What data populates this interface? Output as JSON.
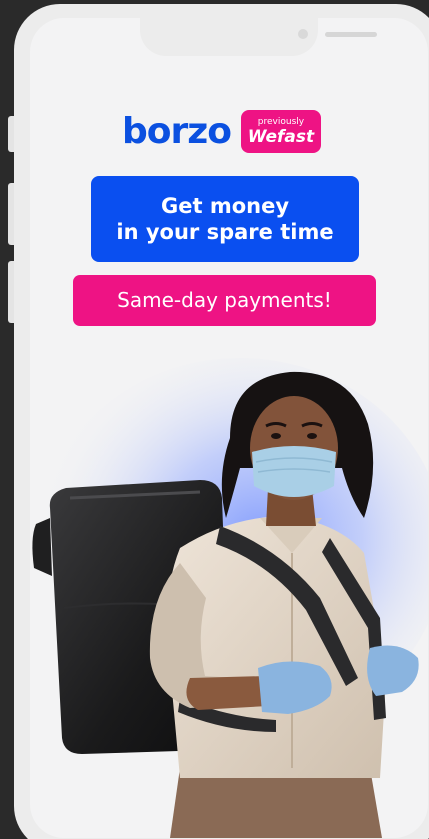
{
  "brand": {
    "name": "borzo",
    "badge_small": "previously",
    "badge_big": "Wefast",
    "blue": "#0b50e0",
    "pink": "#ee1384"
  },
  "hero": {
    "headline_line1": "Get money",
    "headline_line2": "in your spare time",
    "subline": "Same-day payments!"
  },
  "illustration": {
    "subject": "courier-with-backpack-and-mask"
  }
}
